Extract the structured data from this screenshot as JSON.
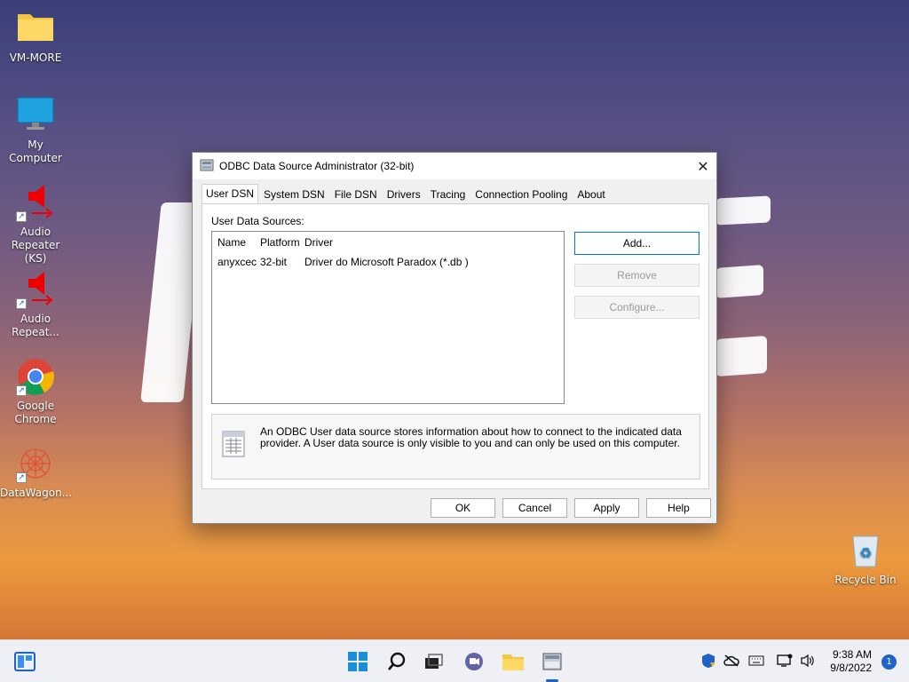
{
  "desktop": {
    "icons": [
      {
        "label": "VM-MORE"
      },
      {
        "label": "My Computer"
      },
      {
        "label": "Audio Repeater (KS)"
      },
      {
        "label": "Audio Repeat..."
      },
      {
        "label": "Google Chrome"
      },
      {
        "label": "DataWagon..."
      },
      {
        "label": "Recycle Bin"
      }
    ]
  },
  "dialog": {
    "title": "ODBC Data Source Administrator (32-bit)",
    "close_glyph": "✕",
    "tabs": [
      {
        "label": "User DSN"
      },
      {
        "label": "System DSN"
      },
      {
        "label": "File DSN"
      },
      {
        "label": "Drivers"
      },
      {
        "label": "Tracing"
      },
      {
        "label": "Connection Pooling"
      },
      {
        "label": "About"
      }
    ],
    "section_label": "User Data Sources:",
    "columns": {
      "name": "Name",
      "platform": "Platform",
      "driver": "Driver"
    },
    "rows": [
      {
        "name": "anyxcec",
        "platform": "32-bit",
        "driver": "Driver do Microsoft Paradox (*.db )"
      }
    ],
    "buttons": {
      "add": "Add...",
      "remove": "Remove",
      "configure": "Configure...",
      "ok": "OK",
      "cancel": "Cancel",
      "apply": "Apply",
      "help": "Help"
    },
    "info_text": "An ODBC User data source stores information about how to connect to the indicated data provider.   A User data source is only visible to you and can only be used on this computer."
  },
  "taskbar": {
    "time": "9:38 AM",
    "date": "9/8/2022",
    "notification_count": "1"
  },
  "colors": {
    "accent": "#0078d7",
    "taskbar": "#eef0f5"
  }
}
